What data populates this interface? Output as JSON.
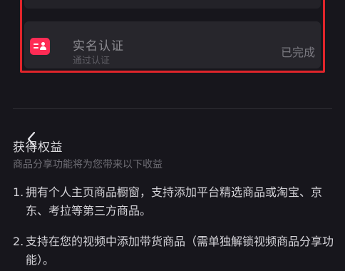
{
  "verification_card": {
    "title": "实名认证",
    "subtitle": "通过认证",
    "status": "已完成",
    "icon": "id-card-icon",
    "accent_color": "#fe2c55",
    "highlight_color": "#e0252b"
  },
  "benefits_section": {
    "title": "获得权益",
    "subtitle": "商品分享功能将为您带来以下收益",
    "items": [
      {
        "number": "1.",
        "text": "拥有个人主页商品橱窗，支持添加平台精选商品或淘宝、京东、考拉等第三方商品。"
      },
      {
        "number": "2.",
        "text": "支持在您的视频中添加带货商品（需单独解锁视频商品分享功能）。"
      }
    ]
  },
  "navigation": {
    "back_icon": "chevron-left-icon"
  }
}
